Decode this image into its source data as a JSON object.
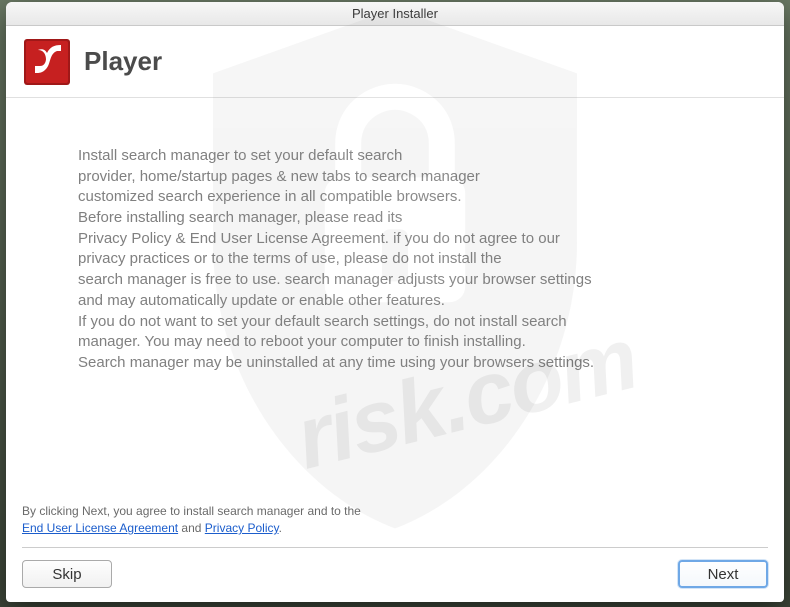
{
  "window": {
    "title": "Player Installer"
  },
  "header": {
    "app_name": "Player"
  },
  "body": {
    "line1": "Install search manager to set your default search",
    "line2": "provider, home/startup pages & new tabs to search manager",
    "line3": "customized search experience in all compatible browsers.",
    "line4": "Before installing search manager, please read its",
    "line5": "Privacy Policy & End User License Agreement. if you do not agree to our",
    "line6": "privacy practices or to the terms of use, please do not install the",
    "line7": "search manager is free to use. search manager adjusts your browser settings",
    "line8": "and may automatically update or enable other features.",
    "line9": "If you do not want to set your default search settings, do not install search",
    "line10": "manager. You may need to reboot your computer to finish installing.",
    "line11": "Search manager may be uninstalled at any time using your browsers settings."
  },
  "footer": {
    "pretext": "By clicking Next, you agree to install search manager and to the",
    "link_eula": "End User License Agreement",
    "and": " and ",
    "link_privacy": "Privacy Policy",
    "period": "."
  },
  "buttons": {
    "skip": "Skip",
    "next": "Next"
  },
  "watermark": {
    "text": "risk.com"
  }
}
